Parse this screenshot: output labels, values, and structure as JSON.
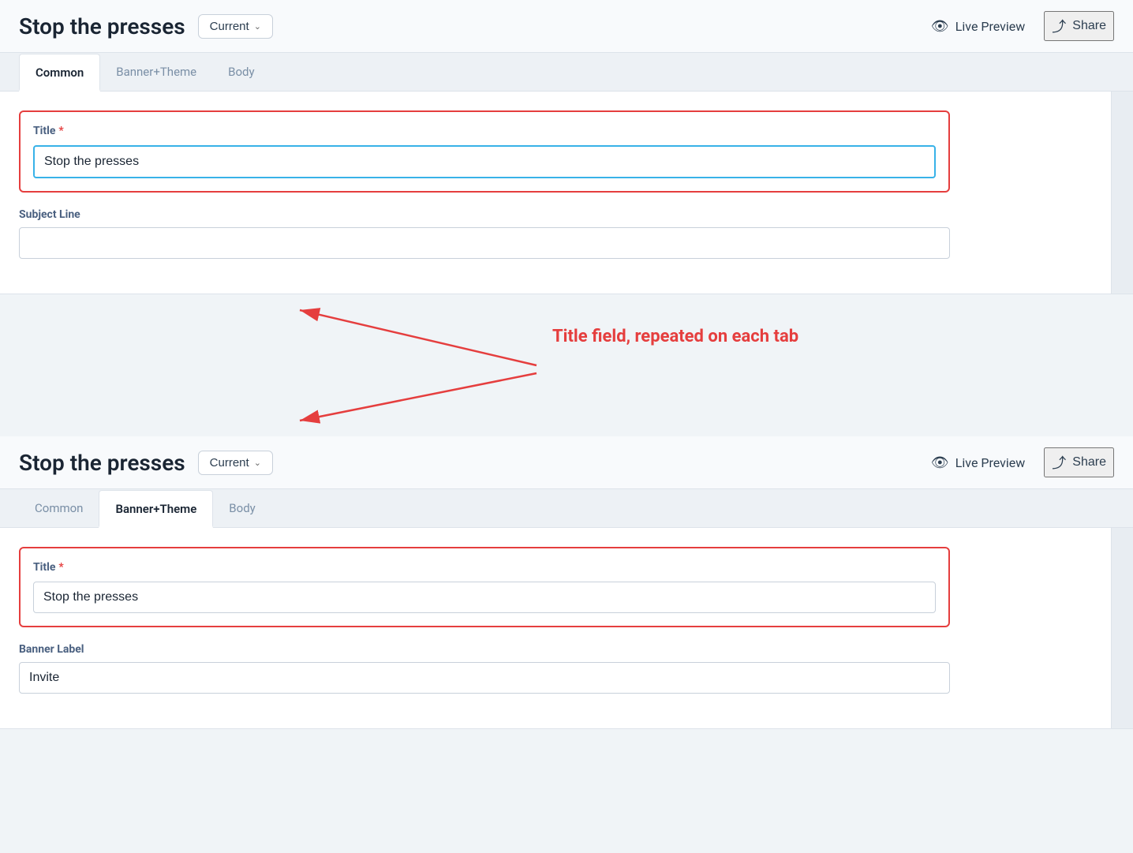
{
  "panel1": {
    "title": "Stop the presses",
    "version_label": "Current",
    "version_chevron": "∨",
    "live_preview_label": "Live Preview",
    "share_label": "Share",
    "tabs": [
      {
        "id": "common",
        "label": "Common",
        "active": true
      },
      {
        "id": "banner-theme",
        "label": "Banner+Theme",
        "active": false
      },
      {
        "id": "body",
        "label": "Body",
        "active": false
      }
    ],
    "title_field": {
      "label": "Title",
      "required": true,
      "value": "Stop the presses",
      "placeholder": ""
    },
    "subject_line_field": {
      "label": "Subject Line",
      "value": "",
      "placeholder": ""
    }
  },
  "annotation": {
    "text": "Title field, repeated on each tab"
  },
  "panel2": {
    "title": "Stop the presses",
    "version_label": "Current",
    "version_chevron": "∨",
    "live_preview_label": "Live Preview",
    "share_label": "Share",
    "tabs": [
      {
        "id": "common",
        "label": "Common",
        "active": false
      },
      {
        "id": "banner-theme",
        "label": "Banner+Theme",
        "active": true
      },
      {
        "id": "body",
        "label": "Body",
        "active": false
      }
    ],
    "title_field": {
      "label": "Title",
      "required": true,
      "value": "Stop the presses",
      "placeholder": ""
    },
    "banner_label_field": {
      "label": "Banner Label",
      "value": "Invite",
      "placeholder": ""
    }
  },
  "icons": {
    "eye": "👁",
    "share": "↪",
    "chevron_down": "∨"
  }
}
